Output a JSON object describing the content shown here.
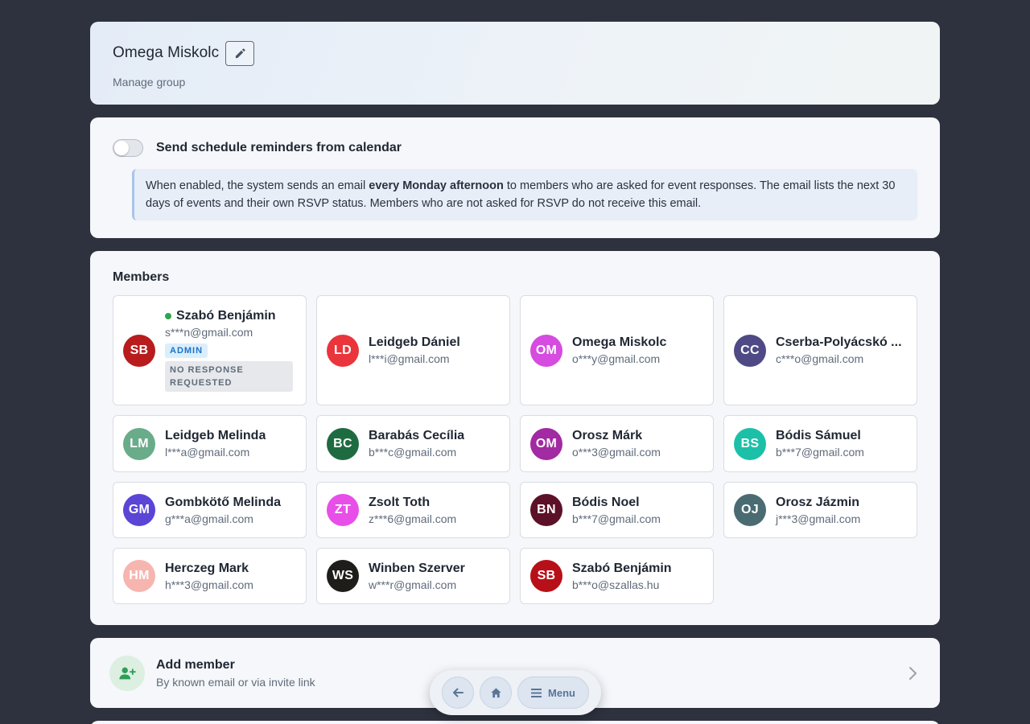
{
  "header": {
    "title": "Omega Miskolc",
    "subtitle": "Manage group",
    "edit_icon": "pencil-icon"
  },
  "reminders": {
    "enabled": false,
    "label": "Send schedule reminders from calendar",
    "info_before": "When enabled, the system sends an email ",
    "info_bold": "every Monday afternoon",
    "info_after": " to members who are asked for event responses. The email lists the next 30 days of events and their own RSVP status. Members who are not asked for RSVP do not receive this email."
  },
  "members": {
    "title": "Members",
    "list": [
      {
        "initials": "SB",
        "name": "Szabó Benjámin",
        "email": "s***n@gmail.com",
        "color": "#b81c1c",
        "online": true,
        "badge": "ADMIN",
        "status": "NO RESPONSE REQUESTED"
      },
      {
        "initials": "LD",
        "name": "Leidgeb Dániel",
        "email": "l***i@gmail.com",
        "color": "#e9353b"
      },
      {
        "initials": "OM",
        "name": "Omega Miskolc",
        "email": "o***y@gmail.com",
        "color": "#d64be0"
      },
      {
        "initials": "CC",
        "name": "Cserba-Polyácskó ...",
        "email": "c***o@gmail.com",
        "color": "#4f4a85"
      },
      {
        "initials": "LM",
        "name": "Leidgeb Melinda",
        "email": "l***a@gmail.com",
        "color": "#6aab8a"
      },
      {
        "initials": "BC",
        "name": "Barabás Cecília",
        "email": "b***c@gmail.com",
        "color": "#1f6b41"
      },
      {
        "initials": "OM",
        "name": "Orosz Márk",
        "email": "o***3@gmail.com",
        "color": "#a22aa2"
      },
      {
        "initials": "BS",
        "name": "Bódis Sámuel",
        "email": "b***7@gmail.com",
        "color": "#1cc0a8"
      },
      {
        "initials": "GM",
        "name": "Gombkötő Melinda",
        "email": "g***a@gmail.com",
        "color": "#5a45d6"
      },
      {
        "initials": "ZT",
        "name": "Zsolt Toth",
        "email": "z***6@gmail.com",
        "color": "#e84fe8"
      },
      {
        "initials": "BN",
        "name": "Bódis Noel",
        "email": "b***7@gmail.com",
        "color": "#5c1129"
      },
      {
        "initials": "OJ",
        "name": "Orosz Jázmin",
        "email": "j***3@gmail.com",
        "color": "#4a6b72"
      },
      {
        "initials": "HM",
        "name": "Herczeg Mark",
        "email": "h***3@gmail.com",
        "color": "#f7b5b0"
      },
      {
        "initials": "WS",
        "name": "Winben Szerver",
        "email": "w***r@gmail.com",
        "color": "#1f1d1a"
      },
      {
        "initials": "SB",
        "name": "Szabó Benjámin",
        "email": "b***o@szallas.hu",
        "color": "#b81018"
      }
    ]
  },
  "add_member": {
    "title": "Add member",
    "subtitle": "By known email or via invite link",
    "icon": "add-person-icon"
  },
  "nav": {
    "back_icon": "arrow-left-icon",
    "home_icon": "home-icon",
    "menu_label": "Menu",
    "menu_icon": "hamburger-icon"
  }
}
